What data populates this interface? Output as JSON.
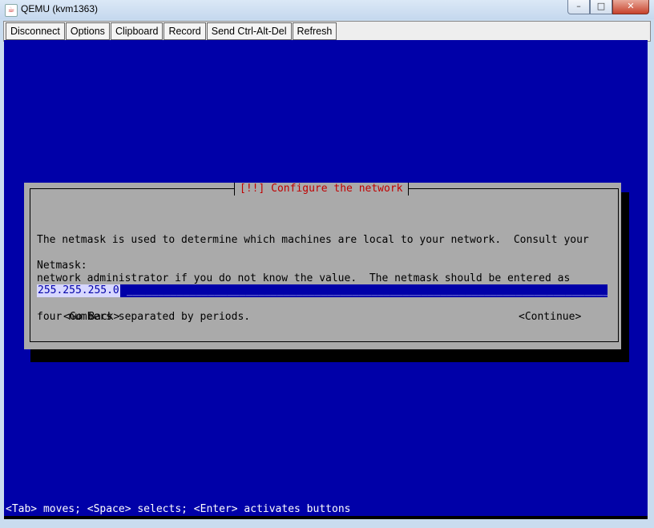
{
  "window": {
    "title": "QEMU (kvm1363)",
    "icon": "java-icon",
    "controls": {
      "minimize": "–",
      "maximize": "□",
      "close": "✕"
    }
  },
  "toolbar": {
    "buttons": [
      "Disconnect",
      "Options",
      "Clipboard",
      "Record",
      "Send Ctrl-Alt-Del",
      "Refresh"
    ]
  },
  "dialog": {
    "title": "[!!] Configure the network",
    "message_lines": [
      "The netmask is used to determine which machines are local to your network.  Consult your",
      "network administrator if you do not know the value.  The netmask should be entered as",
      "four numbers separated by periods."
    ],
    "field_label": "Netmask:",
    "field_value": "255.255.255.0",
    "go_back": "<Go Back>",
    "continue": "<Continue>"
  },
  "status_line": "<Tab> moves; <Space> selects; <Enter> activates buttons",
  "colors": {
    "screen_bg": "#0000a8",
    "dialog_bg": "#aaaaaa",
    "title_red": "#c00000"
  }
}
